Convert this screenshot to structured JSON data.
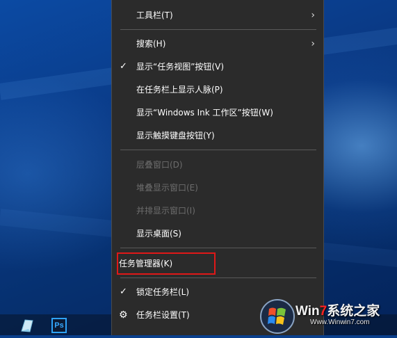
{
  "context_menu": {
    "items": [
      {
        "label": "工具栏(T)",
        "enabled": true,
        "checked": false,
        "submenu": true
      },
      {
        "label": "搜索(H)",
        "enabled": true,
        "checked": false,
        "submenu": true
      },
      {
        "label": "显示“任务视图”按钮(V)",
        "enabled": true,
        "checked": true,
        "submenu": false
      },
      {
        "label": "在任务栏上显示人脉(P)",
        "enabled": true,
        "checked": false,
        "submenu": false
      },
      {
        "label": "显示“Windows Ink 工作区”按钮(W)",
        "enabled": true,
        "checked": false,
        "submenu": false
      },
      {
        "label": "显示触摸键盘按钮(Y)",
        "enabled": true,
        "checked": false,
        "submenu": false
      },
      {
        "label": "层叠窗口(D)",
        "enabled": false,
        "checked": false,
        "submenu": false
      },
      {
        "label": "堆叠显示窗口(E)",
        "enabled": false,
        "checked": false,
        "submenu": false
      },
      {
        "label": "并排显示窗口(I)",
        "enabled": false,
        "checked": false,
        "submenu": false
      },
      {
        "label": "显示桌面(S)",
        "enabled": true,
        "checked": false,
        "submenu": false
      },
      {
        "label": "任务管理器(K)",
        "enabled": true,
        "checked": false,
        "submenu": false,
        "highlighted": true
      },
      {
        "label": "锁定任务栏(L)",
        "enabled": true,
        "checked": true,
        "submenu": false
      },
      {
        "label": "任务栏设置(T)",
        "enabled": true,
        "checked": false,
        "submenu": false,
        "icon": "gear-icon"
      }
    ],
    "check_glyph": "✓",
    "arrow_glyph": "›",
    "gear_glyph": "⚙"
  },
  "taskbar": {
    "icons": [
      {
        "name": "sticky-notes-icon"
      },
      {
        "name": "photoshop-icon",
        "text": "Ps"
      }
    ]
  },
  "watermark": {
    "brand_prefix": "Win",
    "brand_seven": "7",
    "brand_suffix": "系统之家",
    "url": "Www.Winwin7.com"
  },
  "colors": {
    "menu_bg": "#2b2b2b",
    "disabled_text": "#6d6d6d",
    "highlight_border": "#e01818",
    "desktop_blue": "#0a3f8c"
  }
}
